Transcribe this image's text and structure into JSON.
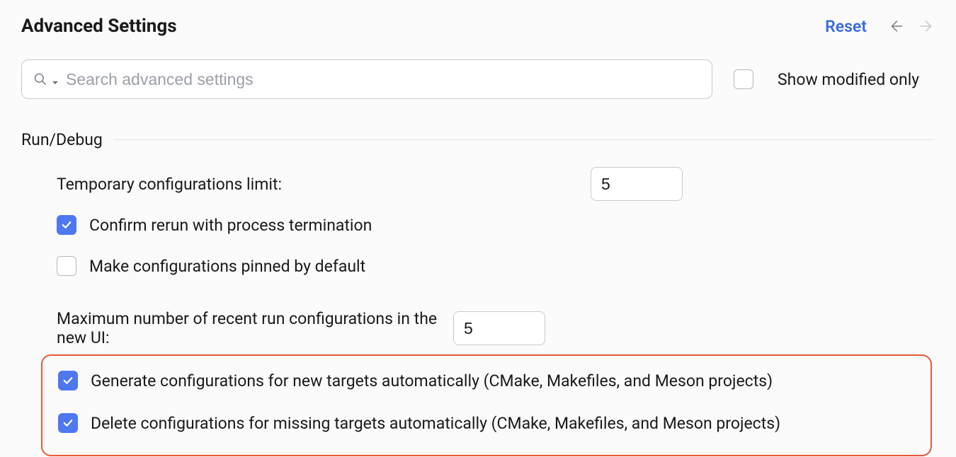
{
  "header": {
    "title": "Advanced Settings",
    "reset_label": "Reset"
  },
  "search": {
    "placeholder": "Search advanced settings",
    "value": ""
  },
  "show_modified_only": {
    "label": "Show modified only",
    "checked": false
  },
  "section": {
    "title": "Run/Debug",
    "settings": {
      "temp_limit": {
        "label": "Temporary configurations limit:",
        "value": "5"
      },
      "confirm_rerun": {
        "label": "Confirm rerun with process termination",
        "checked": true
      },
      "pin_default": {
        "label": "Make configurations pinned by default",
        "checked": false
      },
      "max_recent": {
        "label": "Maximum number of recent run configurations in the new UI:",
        "value": "5"
      },
      "gen_new_targets": {
        "label": "Generate configurations for new targets automatically (CMake, Makefiles, and Meson projects)",
        "checked": true
      },
      "del_missing_targets": {
        "label": "Delete configurations for missing targets automatically (CMake, Makefiles, and Meson projects)",
        "checked": true
      }
    }
  }
}
